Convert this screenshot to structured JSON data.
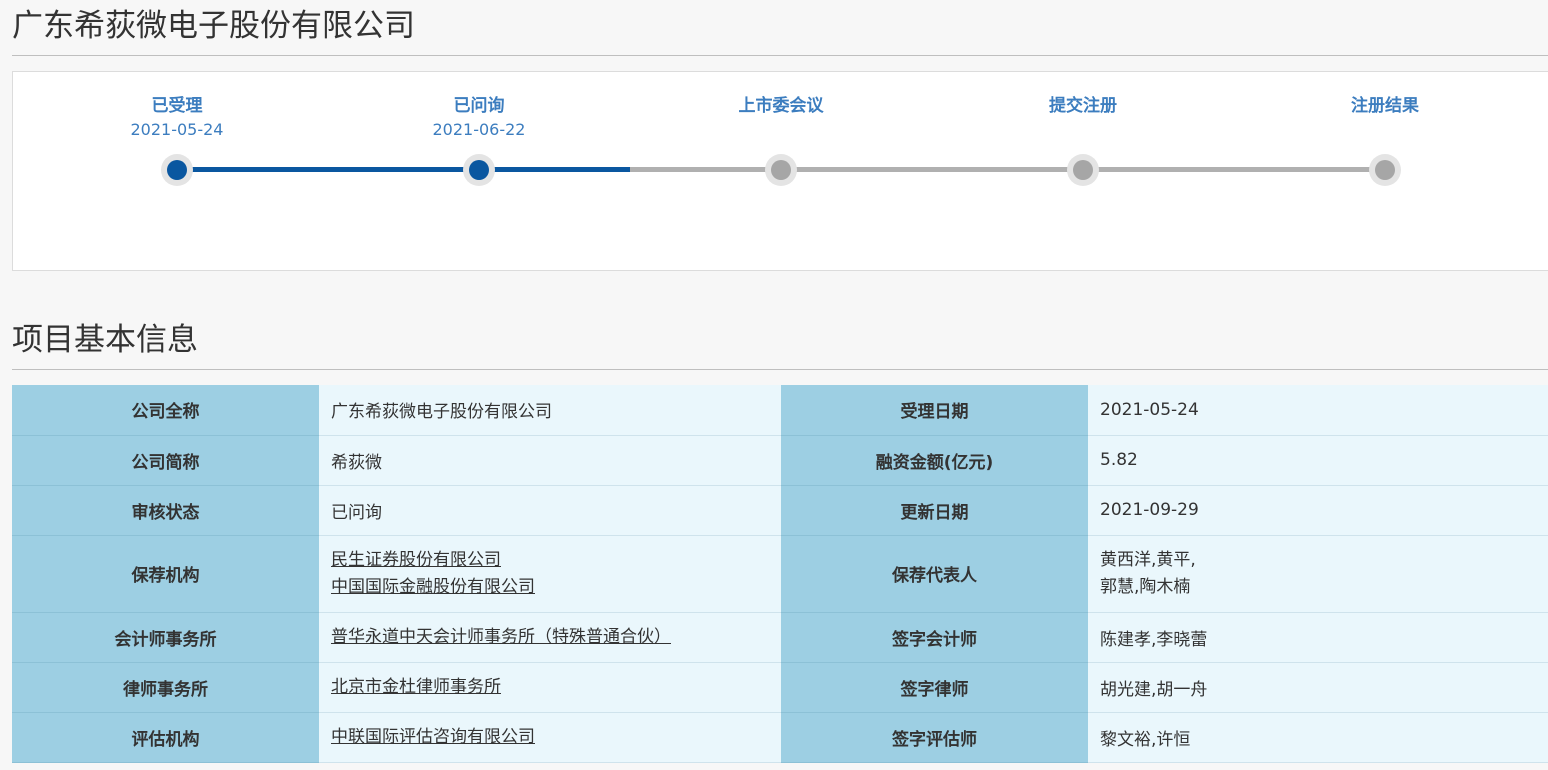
{
  "company_title": "广东希荻微电子股份有限公司",
  "progress": {
    "steps": [
      {
        "label": "已受理",
        "date": "2021-05-24",
        "done": true
      },
      {
        "label": "已问询",
        "date": "2021-06-22",
        "done": true
      },
      {
        "label": "上市委会议",
        "date": "",
        "done": false
      },
      {
        "label": "提交注册",
        "date": "",
        "done": false
      },
      {
        "label": "注册结果",
        "date": "",
        "done": false
      }
    ],
    "fill_fraction": 0.375,
    "active_color": "#0a57a0",
    "inactive_color": "#b0b0b0"
  },
  "section_title": "项目基本信息",
  "info": {
    "full_name_label": "公司全称",
    "full_name": "广东希荻微电子股份有限公司",
    "accept_date_label": "受理日期",
    "accept_date": "2021-05-24",
    "short_name_label": "公司简称",
    "short_name": "希荻微",
    "financing_label": "融资金额(亿元)",
    "financing": "5.82",
    "status_label": "审核状态",
    "status": "已问询",
    "update_date_label": "更新日期",
    "update_date": "2021-09-29",
    "sponsor_label": "保荐机构",
    "sponsors": [
      "民生证券股份有限公司",
      "中国国际金融股份有限公司"
    ],
    "sponsor_rep_label": "保荐代表人",
    "sponsor_reps": [
      "黄西洋,黄平,",
      "郭慧,陶木楠"
    ],
    "accounting_label": "会计师事务所",
    "accounting": "普华永道中天会计师事务所（特殊普通合伙）",
    "accountant_label": "签字会计师",
    "accountants": "陈建孝,李晓蕾",
    "law_label": "律师事务所",
    "law_firm": "北京市金杜律师事务所",
    "lawyer_label": "签字律师",
    "lawyers": "胡光建,胡一舟",
    "appraisal_label": "评估机构",
    "appraisal": "中联国际评估咨询有限公司",
    "appraiser_label": "签字评估师",
    "appraisers": "黎文裕,许恒"
  }
}
